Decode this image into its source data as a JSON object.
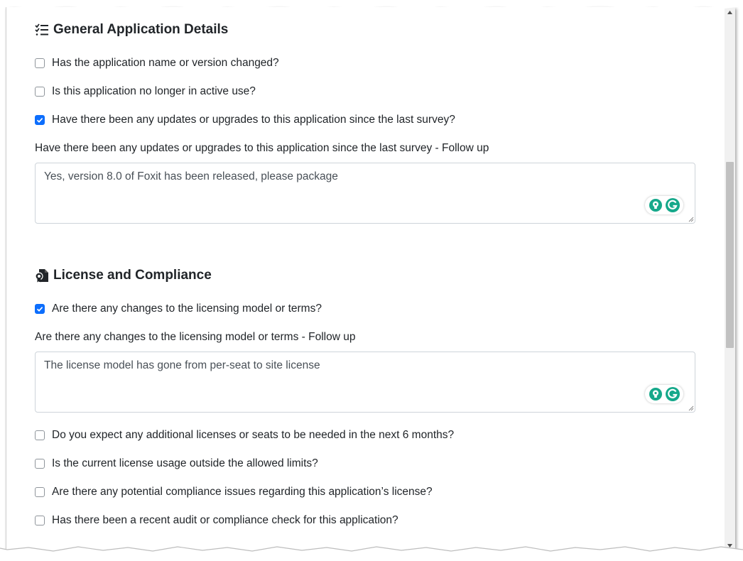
{
  "sections": {
    "general": {
      "title": "General Application Details",
      "icon": "checklist-icon",
      "questions": [
        {
          "label": "Has the application name or version changed?",
          "checked": false
        },
        {
          "label": "Is this application no longer in active use?",
          "checked": false
        },
        {
          "label": "Have there been any updates or upgrades to this application since the last survey?",
          "checked": true
        }
      ],
      "followup": {
        "label": "Have there been any updates or upgrades to this application since the last survey - Follow up",
        "value": "Yes, version 8.0 of Foxit has been released, please package"
      }
    },
    "license": {
      "title": "License and Compliance",
      "icon": "license-file-icon",
      "questions_before": [
        {
          "label": "Are there any changes to the licensing model or terms?",
          "checked": true
        }
      ],
      "followup": {
        "label": "Are there any changes to the licensing model or terms - Follow up",
        "value": "The license model has gone from per-seat to site license"
      },
      "questions_after": [
        {
          "label": "Do you expect any additional licenses or seats to be needed in the next 6 months?",
          "checked": false
        },
        {
          "label": "Is the current license usage outside the allowed limits?",
          "checked": false
        },
        {
          "label": "Are there any potential compliance issues regarding this application’s license?",
          "checked": false
        },
        {
          "label": "Has there been a recent audit or compliance check for this application?",
          "checked": false
        }
      ]
    }
  },
  "colors": {
    "checkbox_checked": "#0d6efd",
    "grammarly_green": "#15a88a",
    "text": "#212529"
  }
}
